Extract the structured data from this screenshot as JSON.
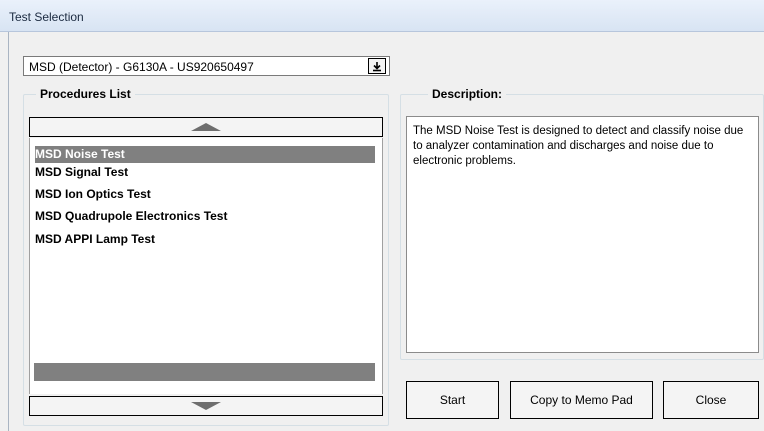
{
  "window": {
    "title": "Test Selection"
  },
  "device_selector": {
    "value": "MSD (Detector) - G6130A - US920650497"
  },
  "procedures": {
    "label": "Procedures List",
    "items": [
      {
        "label": "MSD Noise Test",
        "selected": true
      },
      {
        "label": "MSD Signal Test",
        "selected": false
      },
      {
        "label": "MSD Ion Optics Test",
        "selected": false
      },
      {
        "label": "MSD Quadrupole Electronics Test",
        "selected": false
      },
      {
        "label": "MSD APPI Lamp Test",
        "selected": false
      }
    ]
  },
  "description": {
    "label": "Description:",
    "text": "The MSD Noise Test is designed to detect and classify noise due to analyzer contamination and discharges and noise due to electronic problems."
  },
  "buttons": {
    "start": "Start",
    "copy": "Copy to Memo Pad",
    "close": "Close"
  },
  "colors": {
    "selection": "#808080",
    "title_bar": "#dce7f5"
  },
  "icons": {
    "dropdown": "arrow-down-to-line-icon",
    "scroll_up": "triangle-up-icon",
    "scroll_down": "triangle-down-icon"
  }
}
